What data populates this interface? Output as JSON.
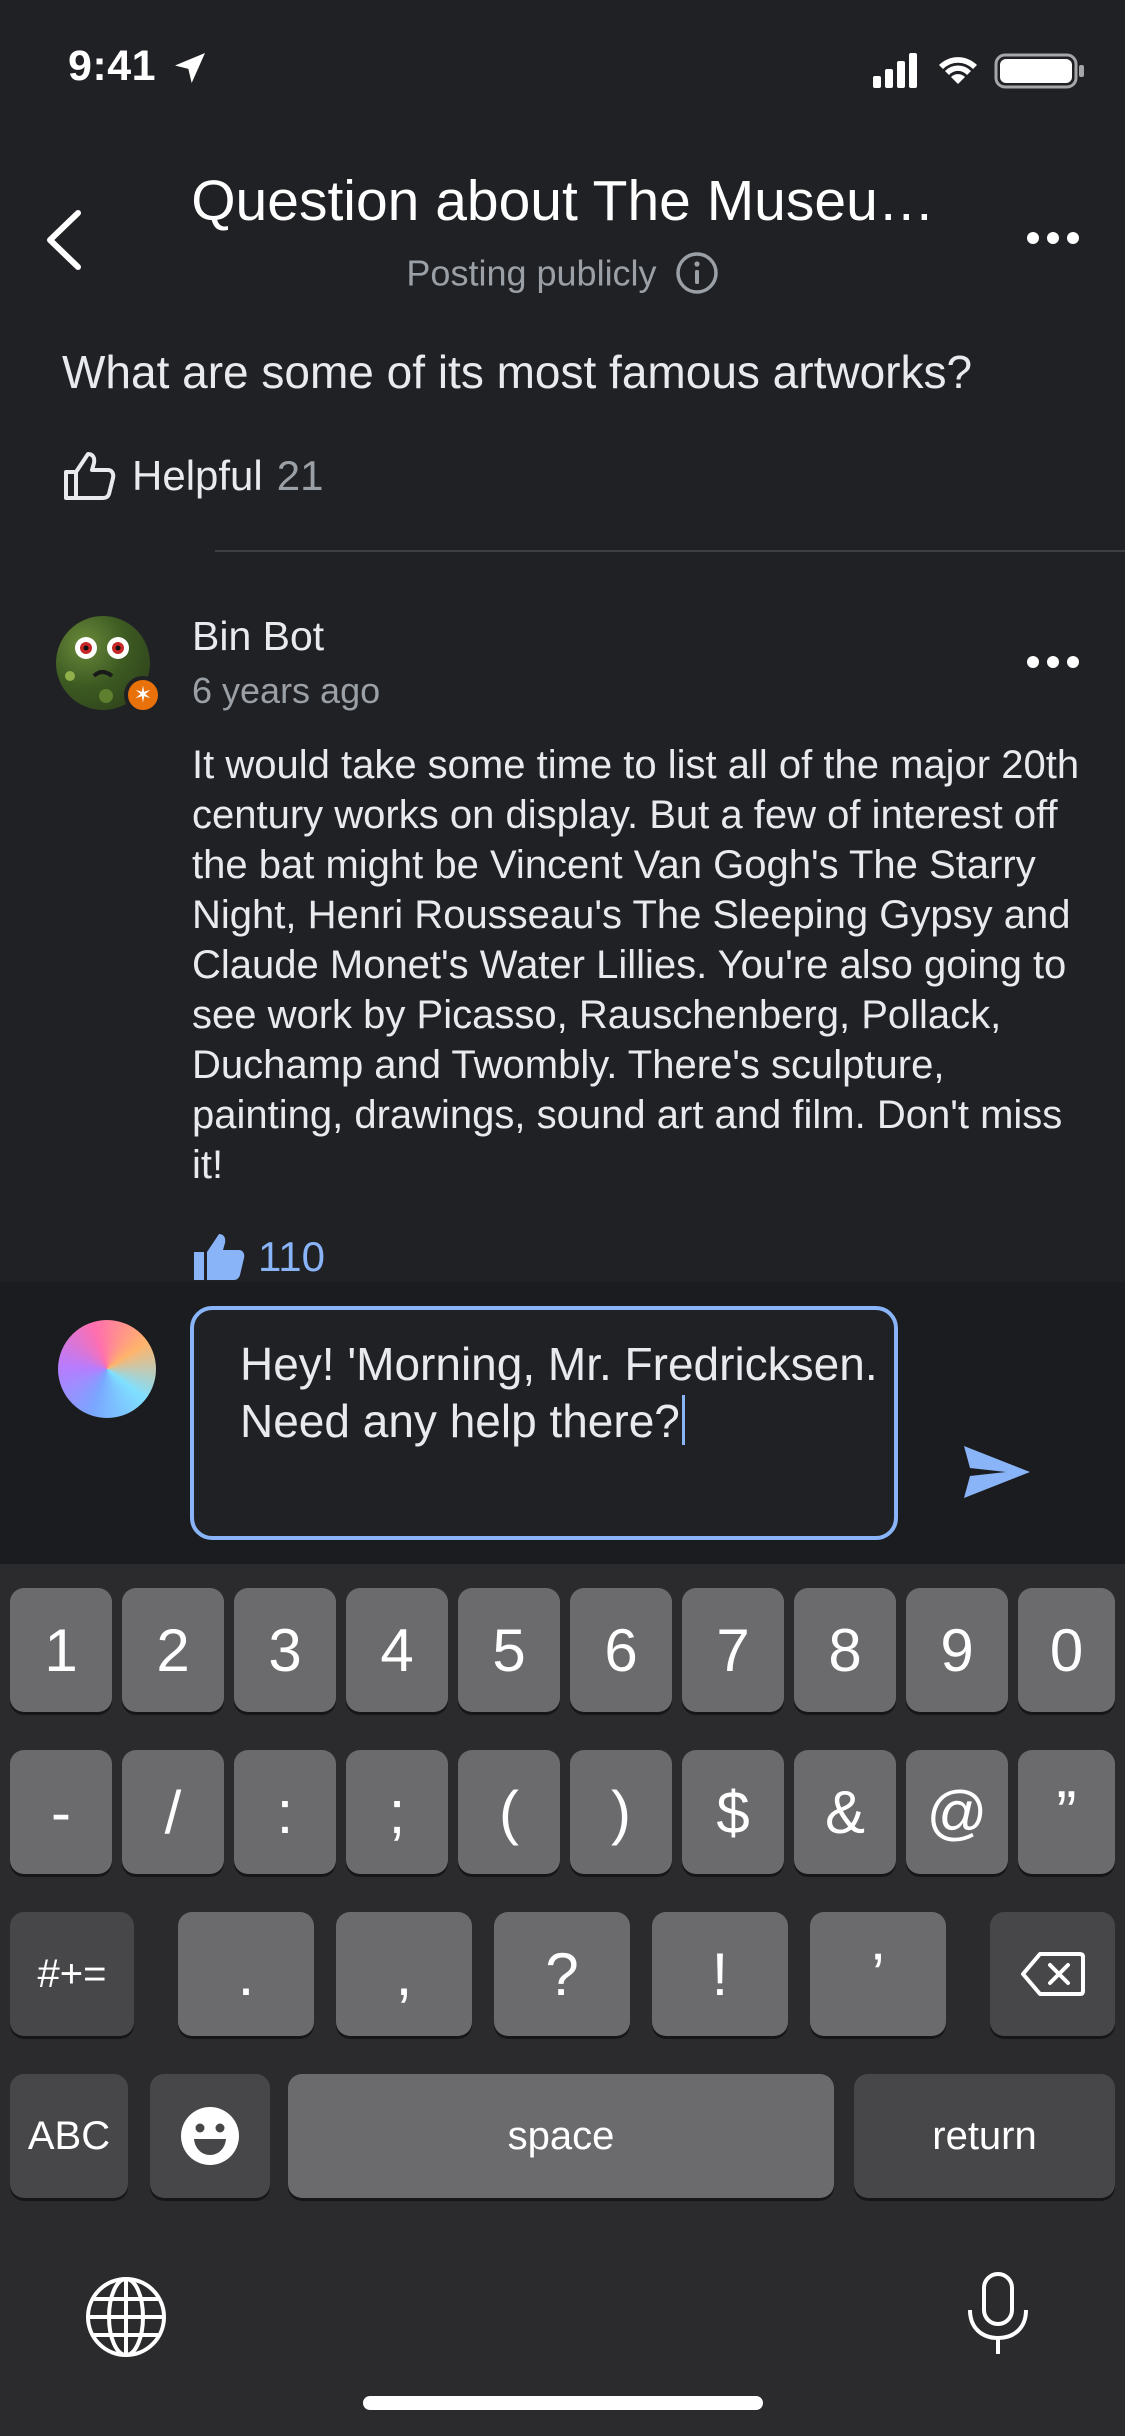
{
  "status_bar": {
    "time": "9:41"
  },
  "header": {
    "title": "Question about The Museu…",
    "subtitle": "Posting publicly"
  },
  "question": {
    "text": "What are some of its most famous artworks?",
    "helpful_label": "Helpful",
    "helpful_count": "21"
  },
  "answer": {
    "author": "Bin Bot",
    "time": "6 years ago",
    "text": "It would take some time to list all of the major 20th century works on display. But a few of interest off the bat might be Vincent Van Gogh's The Starry Night,  Henri Rousseau's The Sleeping Gypsy and Claude Monet's Water Lillies. You're also going to see work by Picasso, Rauschenberg, Pollack, Duchamp and Twombly. There's sculpture, painting, drawings, sound art and film. Don't miss it!",
    "likes": "110"
  },
  "compose": {
    "value": "Hey! 'Morning, Mr. Fredricksen. Need any help there?"
  },
  "keyboard": {
    "row1": [
      "1",
      "2",
      "3",
      "4",
      "5",
      "6",
      "7",
      "8",
      "9",
      "0"
    ],
    "row2": [
      "-",
      "/",
      ":",
      ";",
      "(",
      ")",
      "$",
      "&",
      "@",
      "”"
    ],
    "row3": [
      ".",
      ",",
      "?",
      "!",
      "’"
    ],
    "symbols_key": "#+=",
    "abc_key": "ABC",
    "space_key": "space",
    "return_key": "return"
  },
  "colors": {
    "background": "#202124",
    "accent": "#8ab4f8",
    "badge": "#e8710a",
    "keyboard_bg": "#2b2b2d",
    "key": "#6b6b6e"
  }
}
